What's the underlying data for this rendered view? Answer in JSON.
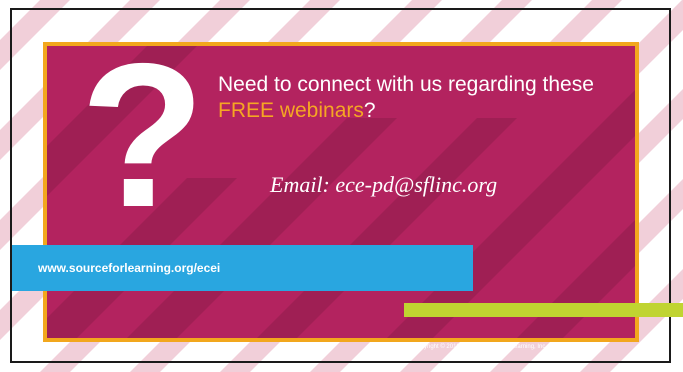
{
  "slide": {
    "heading_part1": "Need to connect with us regarding these ",
    "heading_highlight": "FREE webinars",
    "heading_part2": "?",
    "email_text": "Email: ece-pd@sflinc.org",
    "url_text": "www.sourceforlearning.org/ecei",
    "copyright_text": "Copyright © 2019 by The Source for Learning, Inc. All rights reserved.",
    "question_mark": "?"
  },
  "colors": {
    "panel": "#b3235f",
    "panel_border": "#f2a71d",
    "highlight": "#f5a623",
    "url_bar": "#29a6e0",
    "green_bar": "#c0d431",
    "frame": "#1a1a1a"
  },
  "icons": {
    "question_icon": "question-mark-icon"
  }
}
